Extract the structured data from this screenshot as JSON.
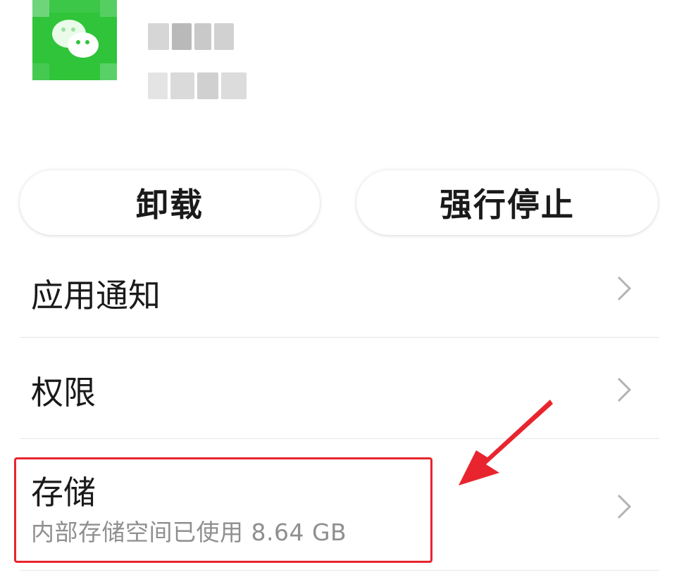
{
  "app": {
    "icon": "wechat-app-icon",
    "name": "微信",
    "version": ""
  },
  "actions": {
    "uninstall_label": "卸载",
    "force_stop_label": "强行停止"
  },
  "settings": {
    "items": [
      {
        "label": "应用通知",
        "icon": "chevron-right-icon"
      },
      {
        "label": "权限",
        "icon": "chevron-right-icon"
      },
      {
        "label": "存储",
        "subtitle": "内部存储空间已使用 8.64 GB",
        "icon": "chevron-right-icon"
      }
    ]
  },
  "annotation": {
    "color": "#e8252e",
    "highlight": "storage-row",
    "arrow": "red-arrow-icon"
  },
  "colors": {
    "app_icon_green": "#2fc43a",
    "divider": "#e6e6e6",
    "subtitle": "#8f8f8f"
  }
}
